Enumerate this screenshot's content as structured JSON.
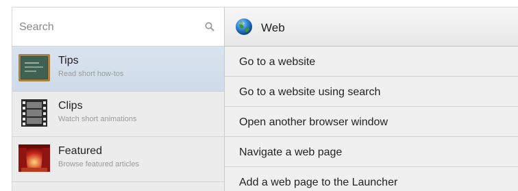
{
  "search": {
    "placeholder": "Search"
  },
  "sidebar": {
    "items": [
      {
        "title": "Tips",
        "subtitle": "Read short how-tos",
        "icon": "chalkboard-icon",
        "selected": true
      },
      {
        "title": "Clips",
        "subtitle": "Watch short animations",
        "icon": "film-strip-icon",
        "selected": false
      },
      {
        "title": "Featured",
        "subtitle": "Browse featured articles",
        "icon": "stage-curtain-icon",
        "selected": false
      }
    ]
  },
  "panel": {
    "title": "Web",
    "icon": "globe-icon",
    "rows": [
      {
        "label": "Go to a website"
      },
      {
        "label": "Go to a website using search"
      },
      {
        "label": "Open another browser window"
      },
      {
        "label": "Navigate a web page"
      },
      {
        "label": "Add a web page to the Launcher"
      }
    ]
  },
  "colors": {
    "selected_bg": "#d4dfec",
    "panel_bg": "#f0f0f0",
    "divider": "#d2d2d2"
  }
}
